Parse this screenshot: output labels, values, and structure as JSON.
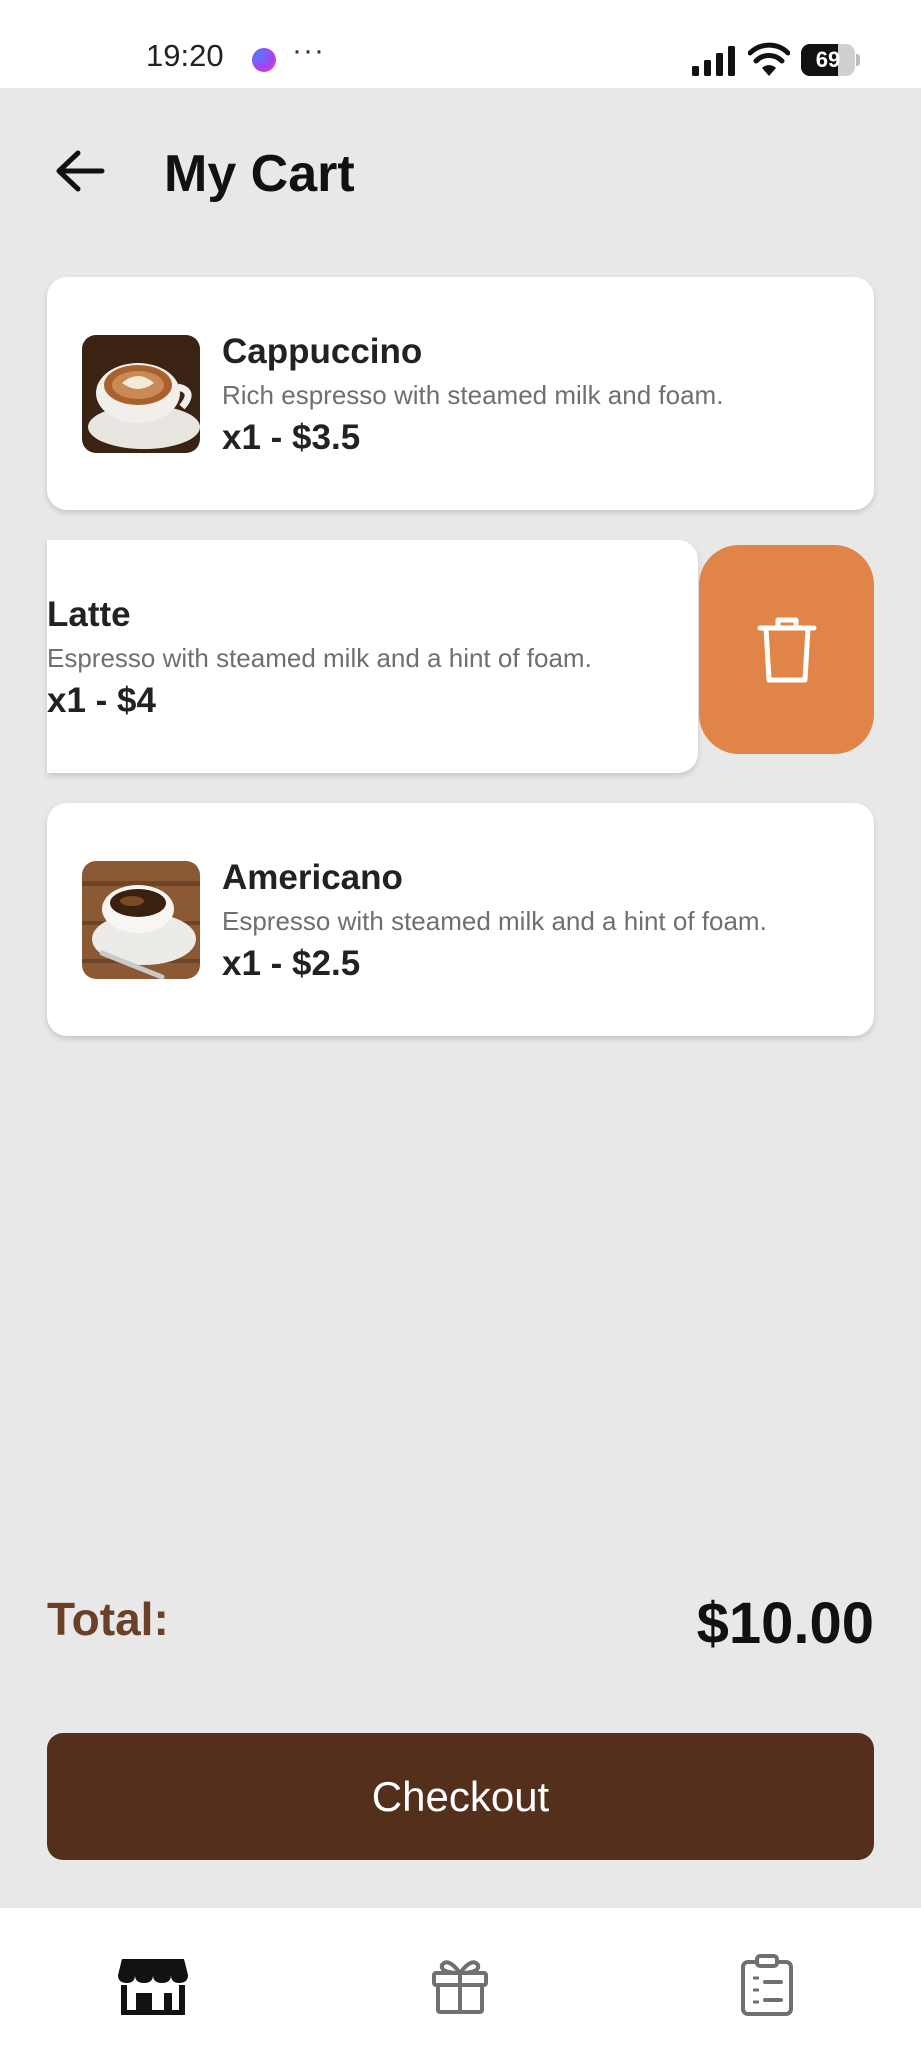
{
  "status_bar": {
    "time": "19:20",
    "more_indicator": "···",
    "battery_level": "69",
    "battery_fraction": 0.69,
    "icons": [
      "messenger-icon",
      "signal-icon",
      "wifi-icon",
      "battery-icon"
    ]
  },
  "header": {
    "back_icon": "arrow-left-icon",
    "title": "My Cart"
  },
  "cart": {
    "items": [
      {
        "name": "Cappuccino",
        "description": "Rich espresso with steamed milk and foam.",
        "price_line": "x1 - $3.5",
        "image": "cappuccino-image"
      },
      {
        "name": "Latte",
        "description": "Espresso with steamed milk and a hint of foam.",
        "price_line": "x1 - $4",
        "image": "latte-image",
        "swiped_open": true
      },
      {
        "name": "Americano",
        "description": "Espresso with steamed milk and a hint of foam.",
        "price_line": "x1 - $2.5",
        "image": "americano-image"
      }
    ],
    "delete_icon": "trash-icon"
  },
  "summary": {
    "total_label": "Total:",
    "total_value": "$10.00"
  },
  "checkout": {
    "label": "Checkout"
  },
  "bottom_nav": {
    "items": [
      {
        "icon": "store-icon",
        "active": true
      },
      {
        "icon": "gift-icon",
        "active": false
      },
      {
        "icon": "order-list-icon",
        "active": false
      }
    ]
  },
  "colors": {
    "background": "#e8e8e8",
    "card": "#ffffff",
    "delete_accent": "#e08447",
    "checkout_button": "#54301c",
    "total_label": "#6b4027"
  }
}
